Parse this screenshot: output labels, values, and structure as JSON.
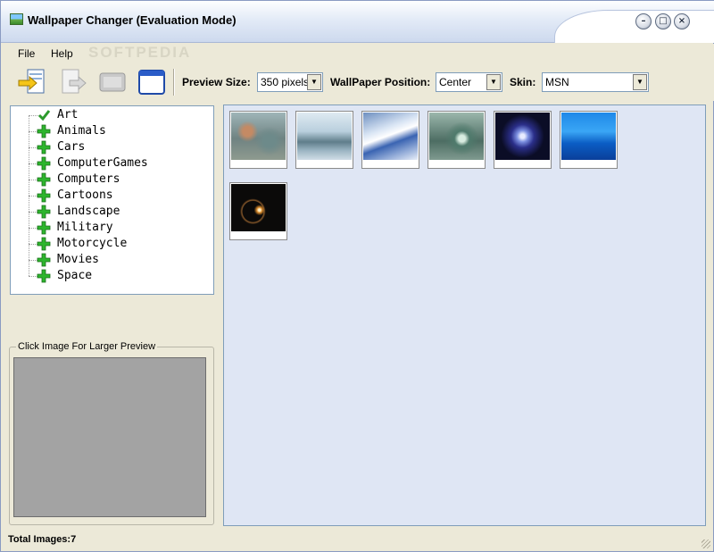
{
  "window": {
    "title": "Wallpaper Changer (Evaluation Mode)",
    "watermark": "SOFTPEDIA"
  },
  "menu": {
    "items": [
      "File",
      "Help"
    ]
  },
  "toolbar": {
    "preview_size_label": "Preview Size:",
    "preview_size_value": "350 pixels",
    "position_label": "WallPaper Position:",
    "position_value": "Center",
    "skin_label": "Skin:",
    "skin_value": "MSN",
    "icons": [
      "apply-wallpaper-icon",
      "next-wallpaper-icon",
      "screen-icon",
      "window-icon"
    ]
  },
  "tree": {
    "items": [
      {
        "label": "Art",
        "icon": "checkmark-icon"
      },
      {
        "label": "Animals",
        "icon": "plus-icon"
      },
      {
        "label": "Cars",
        "icon": "plus-icon"
      },
      {
        "label": "ComputerGames",
        "icon": "plus-icon"
      },
      {
        "label": "Computers",
        "icon": "plus-icon"
      },
      {
        "label": "Cartoons",
        "icon": "plus-icon"
      },
      {
        "label": "Landscape",
        "icon": "plus-icon"
      },
      {
        "label": "Military",
        "icon": "plus-icon"
      },
      {
        "label": "Motorcycle",
        "icon": "plus-icon"
      },
      {
        "label": "Movies",
        "icon": "plus-icon"
      },
      {
        "label": "Space",
        "icon": "plus-icon"
      }
    ]
  },
  "preview": {
    "label": "Click Image For Larger Preview"
  },
  "thumbnails": {
    "count": 7
  },
  "status": {
    "text": "Total Images:7"
  },
  "colors": {
    "accent": "#7f9db9",
    "thumb_area": "#dfe6f4",
    "plus_green": "#2db52d"
  }
}
